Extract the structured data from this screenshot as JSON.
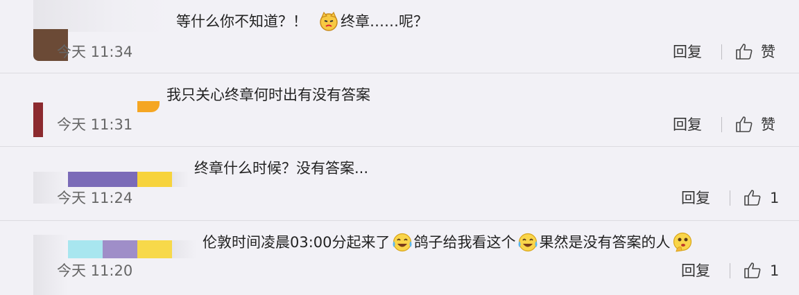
{
  "comments": [
    {
      "text_parts": [
        "等什么你不知道？！",
        "终章……呢？"
      ],
      "time": "今天 11:34",
      "reply": "回复",
      "like": "赞",
      "emoji": [
        "cat-face-icon"
      ]
    },
    {
      "text_parts": [
        "我只关心终章何时出有没有答案"
      ],
      "time": "今天 11:31",
      "reply": "回复",
      "like": "赞"
    },
    {
      "text_parts": [
        "终章什么时候？没有答案..."
      ],
      "time": "今天 11:24",
      "reply": "回复",
      "like": "1"
    },
    {
      "text_parts": [
        "伦敦时间凌晨03:00分起来了",
        "鸽子给我看这个",
        "果然是没有答案的人"
      ],
      "time": "今天 11:20",
      "reply": "回复",
      "like": "1",
      "emoji": [
        "crying-laugh-icon",
        "crying-laugh-icon",
        "thinking-face-icon"
      ]
    }
  ],
  "colors": {
    "background": "#f2f1f6",
    "divider": "#dcdbe0",
    "text": "#222222",
    "time": "#666666"
  }
}
